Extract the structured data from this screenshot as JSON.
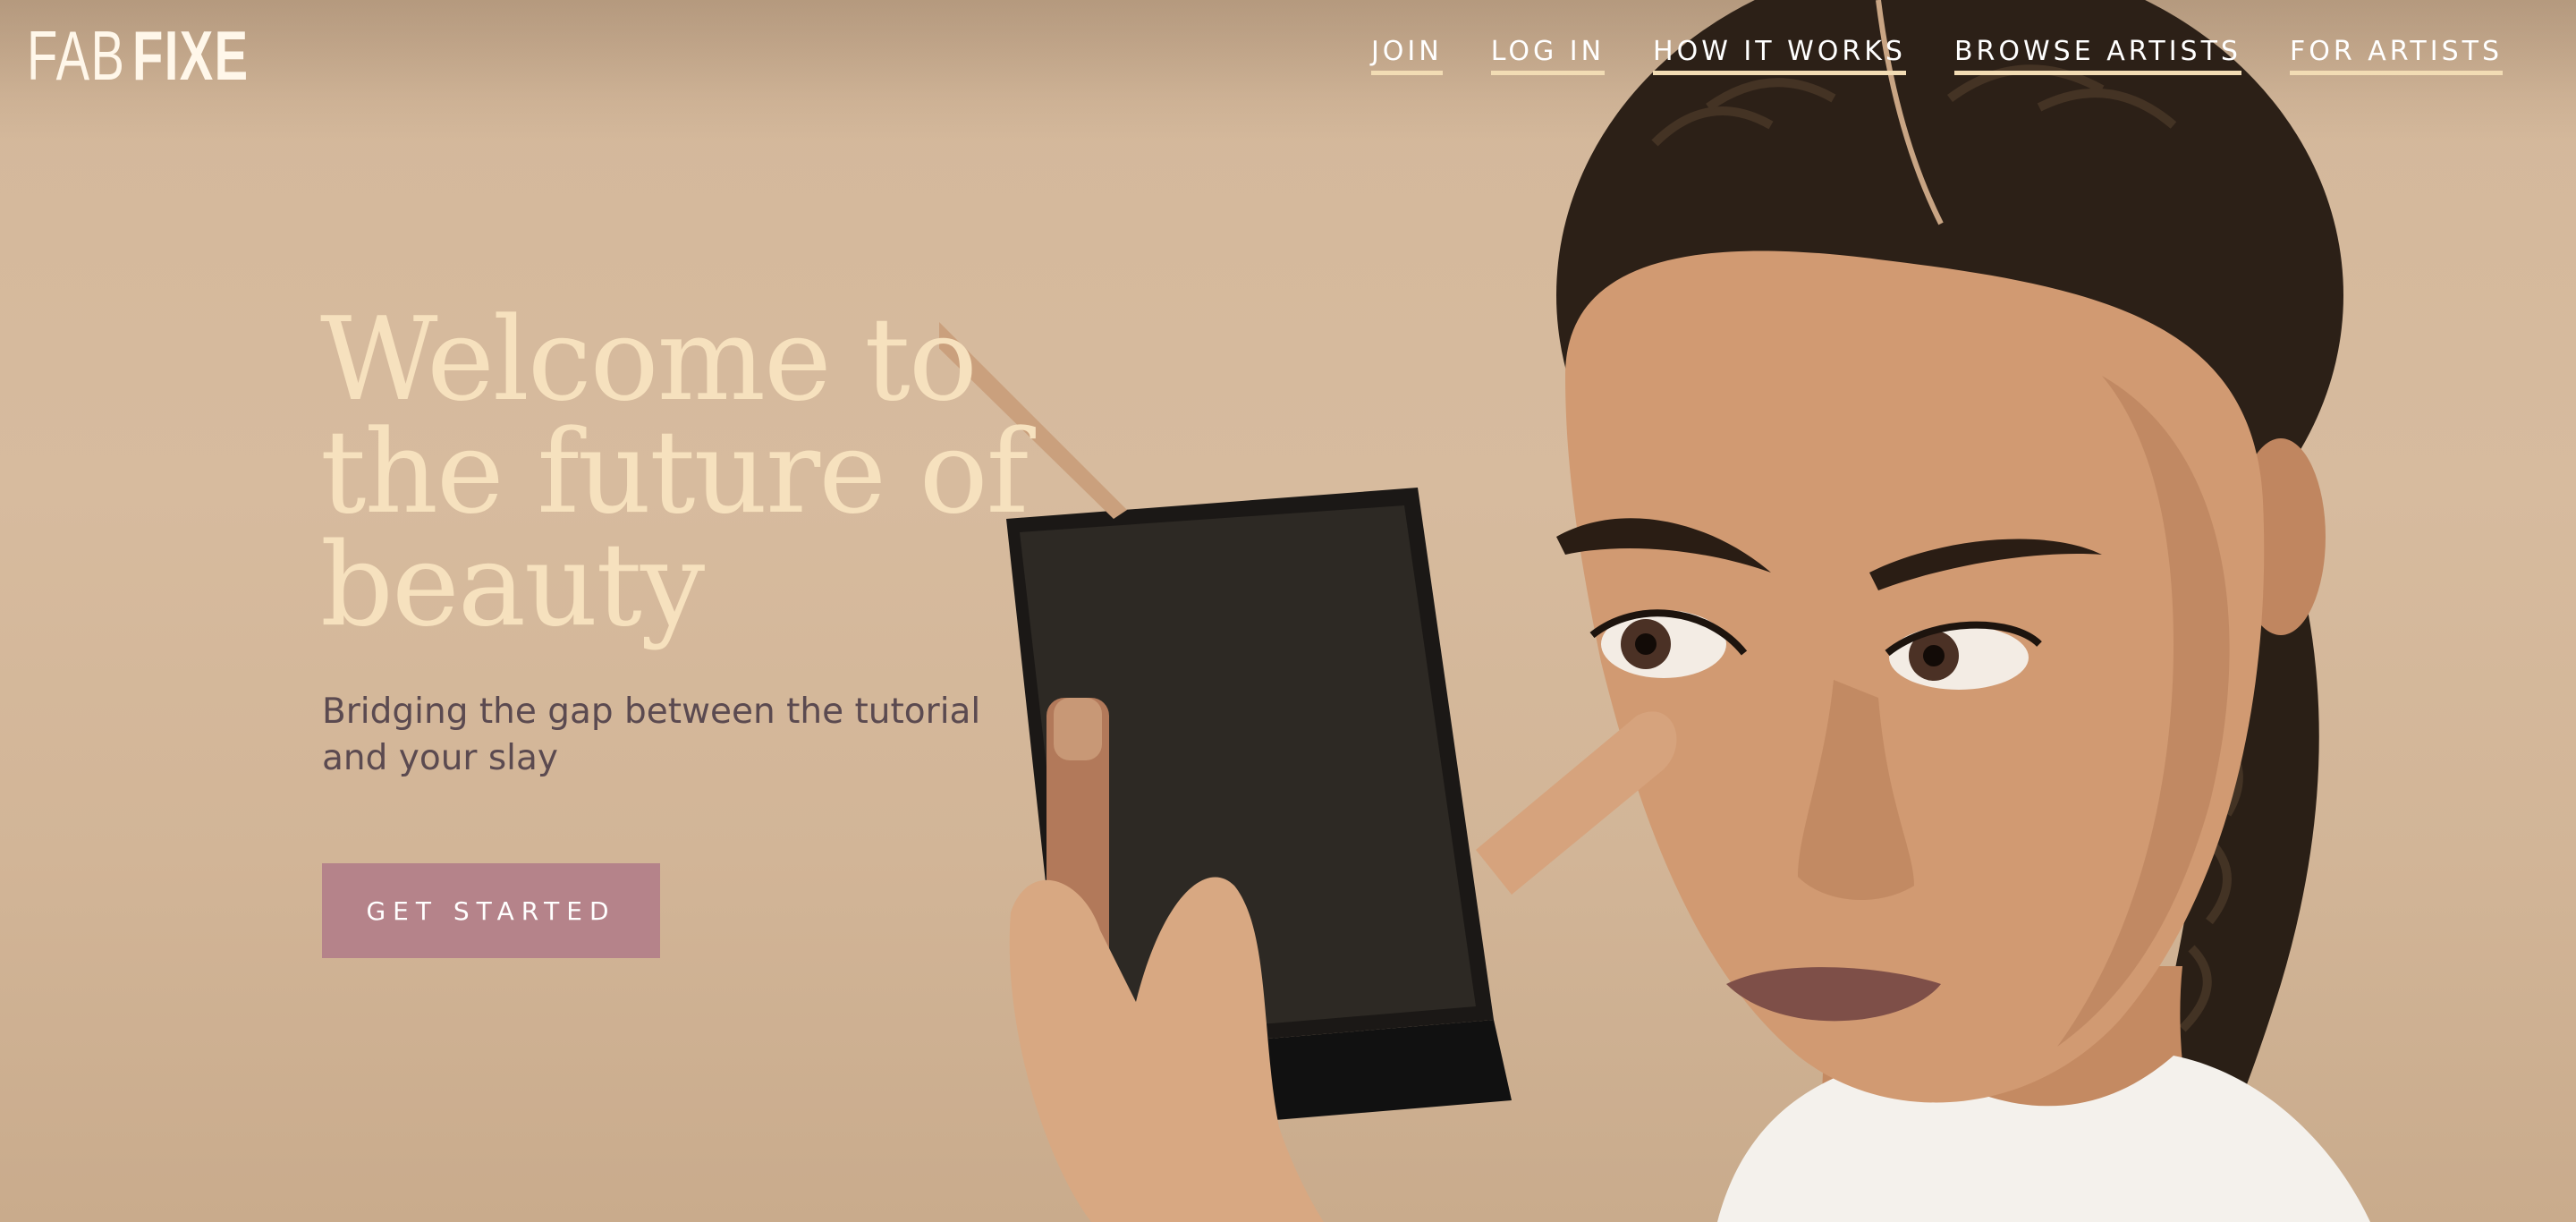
{
  "brand": {
    "logo_light": "FAB",
    "logo_bold": "FIXE"
  },
  "nav": {
    "items": [
      {
        "label": "JOIN"
      },
      {
        "label": "LOG IN"
      },
      {
        "label": "HOW IT WORKS"
      },
      {
        "label": "BROWSE ARTISTS"
      },
      {
        "label": "FOR ARTISTS"
      }
    ],
    "underline_color": "#f2dcb4"
  },
  "hero": {
    "headline": "Welcome to the future of beauty",
    "subheadline": "Bridging the gap between the tutorial and your slay",
    "cta_label": "GET STARTED",
    "cta_color": "#b5838a",
    "headline_color": "#f6e1be",
    "background_color": "#d7bb9e"
  },
  "photo": {
    "subject": "woman applying concealer holding a compact mirror",
    "icons": [
      "compact-mirror-icon",
      "concealer-tube-icon",
      "applicator-wand-icon"
    ]
  }
}
